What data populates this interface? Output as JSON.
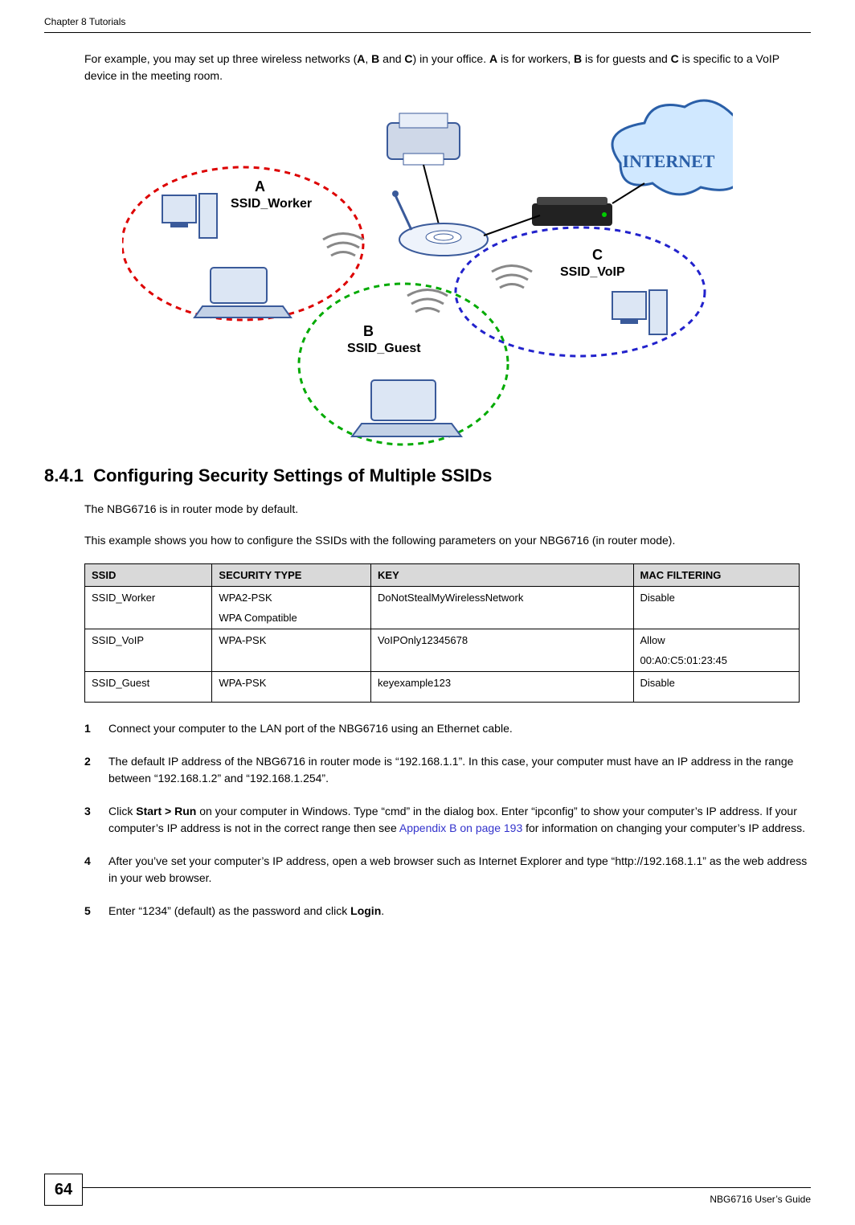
{
  "header": {
    "left": "Chapter 8 Tutorials",
    "right": ""
  },
  "intro": {
    "pre": "For example, you may set up three wireless networks (",
    "a": "A",
    "mid1": ", ",
    "b": "B",
    "mid2": " and ",
    "c": "C",
    "mid3": ") in your office. ",
    "a2": "A",
    "mid4": " is for workers, ",
    "b2": "B",
    "mid5": " is for guests and ",
    "c2": "C",
    "mid6": " is specific to a VoIP device in the meeting room."
  },
  "diagram": {
    "labelA": "A",
    "ssida": "SSID_Worker",
    "labelB": "B",
    "ssidb": "SSID_Guest",
    "labelC": "C",
    "ssidc": "SSID_VoIP",
    "internet": "INTERNET"
  },
  "section": {
    "number": "8.4.1",
    "title": "Configuring Security Settings of Multiple SSIDs"
  },
  "p1": "The NBG6716 is in router mode by default.",
  "p2": "This example shows you how to configure the SSIDs with the following parameters on your NBG6716 (in router mode).",
  "table": {
    "headers": [
      "SSID",
      "SECURITY TYPE",
      "KEY",
      "MAC FILTERING"
    ],
    "rows": [
      {
        "ssid": "SSID_Worker",
        "sec1": "WPA2-PSK",
        "sec2": "WPA Compatible",
        "key": "DoNotStealMyWirelessNetwork",
        "mac1": "Disable",
        "mac2": ""
      },
      {
        "ssid": "SSID_VoIP",
        "sec1": "WPA-PSK",
        "sec2": "",
        "key": "VoIPOnly12345678",
        "mac1": "Allow",
        "mac2": "00:A0:C5:01:23:45"
      },
      {
        "ssid": "SSID_Guest",
        "sec1": "WPA-PSK",
        "sec2": "",
        "key": "keyexample123",
        "mac1": "Disable",
        "mac2": ""
      }
    ]
  },
  "steps": {
    "s1": {
      "n": "1",
      "t": "Connect your computer to the LAN port of the NBG6716 using an Ethernet cable."
    },
    "s2": {
      "n": "2",
      "t": "The default IP address of the NBG6716 in router mode is “192.168.1.1”. In this case, your computer must have an IP address in the range between “192.168.1.2” and “192.168.1.254”."
    },
    "s3": {
      "n": "3",
      "pre": "Click ",
      "bold": "Start > Run",
      "mid": " on your computer in Windows. Type “cmd” in the dialog box. Enter “ipconfig” to show your computer’s IP address. If your computer’s IP address is not in the correct range then see ",
      "link": "Appendix B on page 193",
      "post": " for information on changing your computer’s IP address."
    },
    "s4": {
      "n": "4",
      "t": "After you’ve set your computer’s IP address, open a web browser such as Internet Explorer and type “http://192.168.1.1” as the web address in your web browser."
    },
    "s5": {
      "n": "5",
      "pre": "Enter “1234” (default) as the password and click ",
      "bold": "Login",
      "post": "."
    }
  },
  "footer": {
    "page": "64",
    "guide": "NBG6716 User’s Guide"
  }
}
